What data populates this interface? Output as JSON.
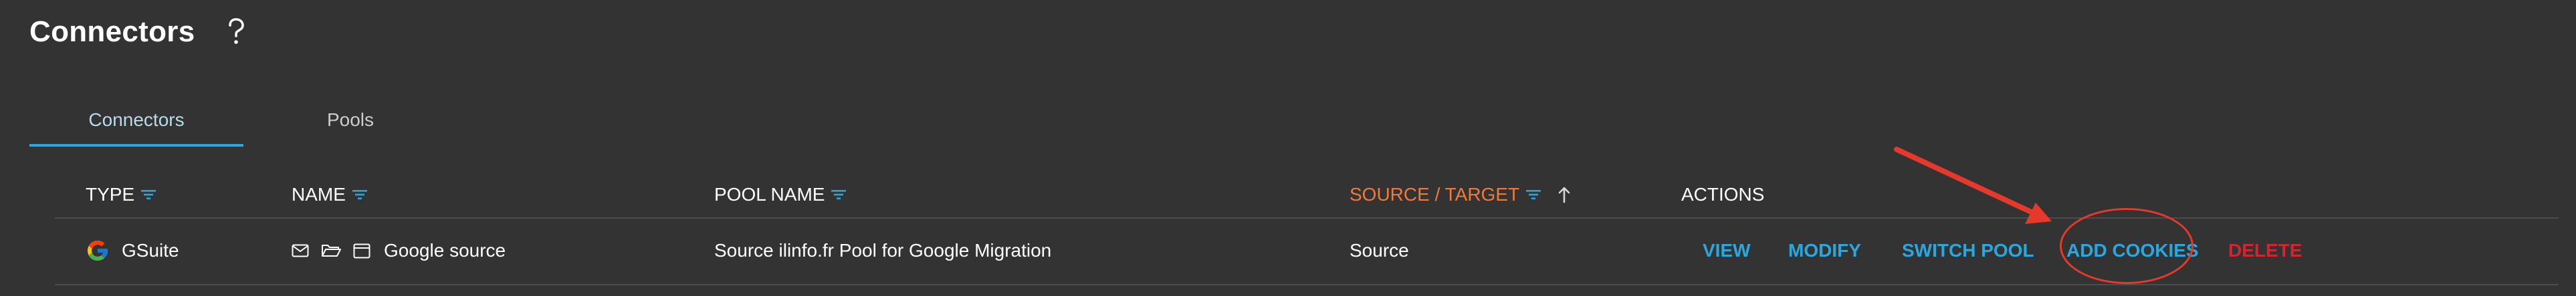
{
  "page": {
    "title": "Connectors",
    "help_icon": "help-question-icon"
  },
  "tabs": [
    {
      "label": "Connectors",
      "active": true
    },
    {
      "label": "Pools",
      "active": false
    }
  ],
  "table": {
    "columns": [
      {
        "key": "type",
        "label": "TYPE",
        "filter": true
      },
      {
        "key": "name",
        "label": "NAME",
        "filter": true
      },
      {
        "key": "pool_name",
        "label": "POOL NAME",
        "filter": true
      },
      {
        "key": "source_target",
        "label": "SOURCE / TARGET",
        "filter": true,
        "sorted": "ascending"
      },
      {
        "key": "actions",
        "label": "ACTIONS",
        "filter": false
      }
    ],
    "rows": [
      {
        "type": "GSuite",
        "type_icon": "google-g-icon",
        "name_icons": [
          "mail-icon",
          "folder-icon",
          "calendar-icon"
        ],
        "name": "Google source",
        "pool_name": "Source ilinfo.fr Pool for Google Migration",
        "source_target": "Source",
        "actions": [
          "VIEW",
          "MODIFY",
          "SWITCH POOL",
          "ADD COOKIES",
          "DELETE"
        ]
      }
    ]
  },
  "colors": {
    "background": "#333333",
    "accent_blue": "#29a8df",
    "sorted_orange": "#f07a3a",
    "delete_red": "#d0262f",
    "annotation_red": "#e53a2b"
  },
  "annotation": {
    "highlighted_action": "ADD COOKIES"
  }
}
